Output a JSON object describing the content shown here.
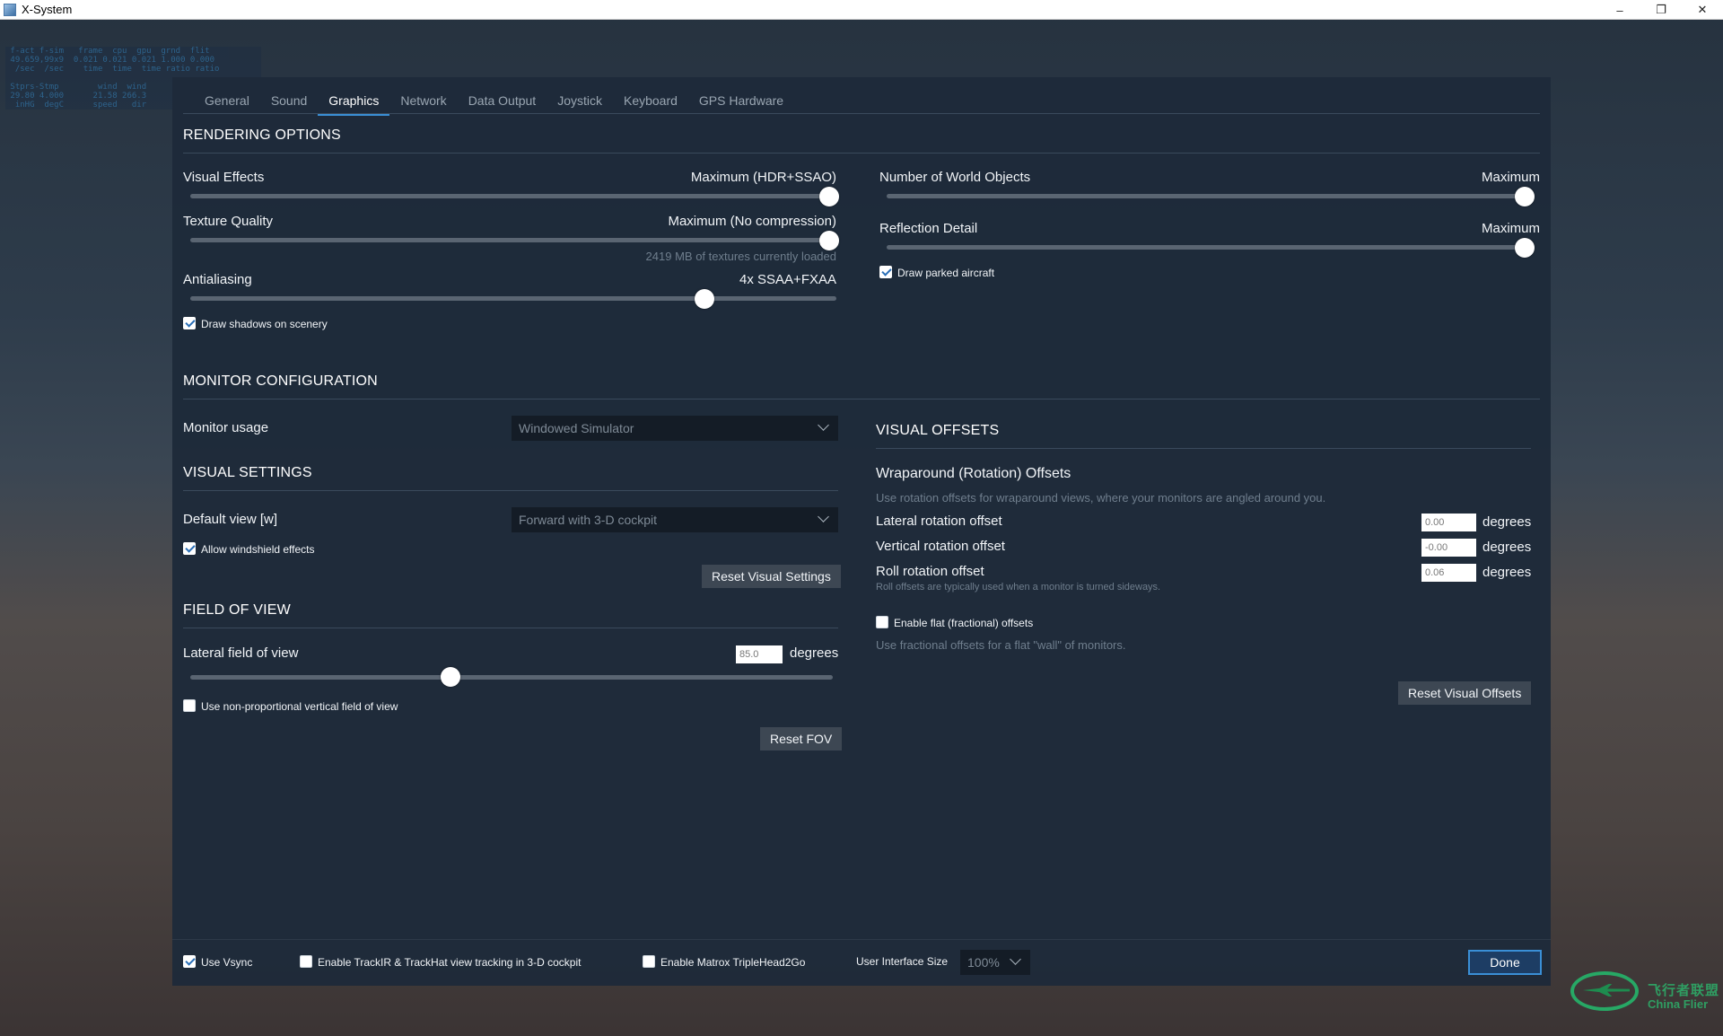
{
  "window": {
    "title": "X-System"
  },
  "debug_overlay": {
    "lines": [
      " f-act f-sim   frame  cpu  gpu  grnd  flit",
      " 49.659,99x9  0.021 0.021 0.021 1.000 0.000",
      "  /sec  /sec    time  time  time ratio ratio",
      "",
      " Stprs-Stmp        wind  wind",
      " 29.80 4.000      21.58 266.3",
      "  inHG  degC      speed   dir"
    ]
  },
  "tabs": [
    "General",
    "Sound",
    "Graphics",
    "Network",
    "Data Output",
    "Joystick",
    "Keyboard",
    "GPS Hardware"
  ],
  "active_tab": "Graphics",
  "rendering": {
    "title": "RENDERING OPTIONS",
    "visual_effects": {
      "label": "Visual Effects",
      "value": "Maximum (HDR+SSAO)",
      "level": 1.0
    },
    "texture_quality": {
      "label": "Texture Quality",
      "value": "Maximum (No compression)",
      "note": "2419 MB of textures currently loaded",
      "level": 1.0
    },
    "antialiasing": {
      "label": "Antialiasing",
      "value": "4x SSAA+FXAA",
      "level": 0.8
    },
    "draw_shadows": {
      "label": "Draw shadows on scenery",
      "checked": true
    },
    "world_objects": {
      "label": "Number of World Objects",
      "value": "Maximum",
      "level": 1.0
    },
    "reflection_detail": {
      "label": "Reflection Detail",
      "value": "Maximum",
      "level": 1.0
    },
    "draw_parked": {
      "label": "Draw parked aircraft",
      "checked": true
    }
  },
  "monitor": {
    "title": "MONITOR CONFIGURATION",
    "usage_label": "Monitor usage",
    "usage_value": "Windowed Simulator"
  },
  "visual_settings": {
    "title": "VISUAL SETTINGS",
    "default_view_label": "Default view [w]",
    "default_view_value": "Forward with 3-D cockpit",
    "windshield": {
      "label": "Allow windshield effects",
      "checked": true
    },
    "reset_label": "Reset Visual Settings"
  },
  "fov": {
    "title": "FIELD OF VIEW",
    "lateral_label": "Lateral field of view",
    "lateral_value": "85.0",
    "unit": "degrees",
    "level": 0.41,
    "nonprop": {
      "label": "Use non-proportional vertical field of view",
      "checked": false
    },
    "reset_label": "Reset FOV"
  },
  "visual_offsets": {
    "title": "VISUAL OFFSETS",
    "wrap_title": "Wraparound (Rotation) Offsets",
    "wrap_hint": "Use rotation offsets for wraparound views, where your monitors are angled around you.",
    "lateral": {
      "label": "Lateral rotation offset",
      "value": "0.00",
      "unit": "degrees"
    },
    "vertical": {
      "label": "Vertical rotation offset",
      "value": "-0.00",
      "unit": "degrees"
    },
    "roll": {
      "label": "Roll rotation offset",
      "value": "0.06",
      "unit": "degrees",
      "hint": "Roll offsets are typically used when a monitor is turned sideways."
    },
    "flat": {
      "label": "Enable flat (fractional) offsets",
      "checked": false,
      "hint": "Use fractional offsets for a flat \"wall\" of monitors."
    },
    "reset_label": "Reset Visual Offsets"
  },
  "bottom": {
    "vsync": {
      "label": "Use Vsync",
      "checked": true
    },
    "trackir": {
      "label": "Enable TrackIR & TrackHat view tracking in 3-D cockpit",
      "checked": false
    },
    "matrox": {
      "label": "Enable Matrox TripleHead2Go",
      "checked": false
    },
    "ui_size_label": "User Interface Size",
    "ui_size_value": "100%",
    "done_label": "Done"
  },
  "watermark": {
    "cn": "飞行者联盟",
    "en": "China Flier"
  }
}
